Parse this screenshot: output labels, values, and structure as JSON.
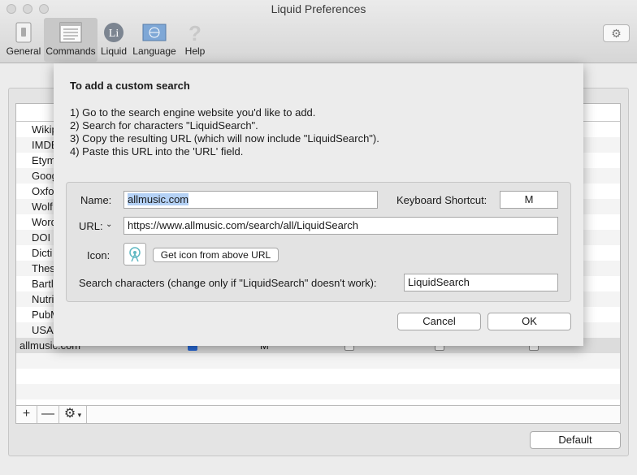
{
  "window": {
    "title": "Liquid Preferences"
  },
  "toolbar": {
    "items": [
      {
        "label": "General",
        "icon": "switch-icon"
      },
      {
        "label": "Commands",
        "icon": "list-window-icon",
        "selected": true
      },
      {
        "label": "Liquid",
        "icon": "liquid-logo-icon"
      },
      {
        "label": "Language",
        "icon": "globe-flag-icon"
      },
      {
        "label": "Help",
        "icon": "question-icon"
      }
    ]
  },
  "table": {
    "rows": [
      {
        "name": "Wikip"
      },
      {
        "name": "IMDB"
      },
      {
        "name": "Etym"
      },
      {
        "name": "Goog"
      },
      {
        "name": "Oxfo"
      },
      {
        "name": "Wolf"
      },
      {
        "name": "Word"
      },
      {
        "name": "DOI l"
      },
      {
        "name": "Dicti"
      },
      {
        "name": "Thes"
      },
      {
        "name": "Bartl"
      },
      {
        "name": "Nutri"
      },
      {
        "name": "PubM"
      },
      {
        "name": "USA"
      },
      {
        "name": "allmusic.com",
        "shortcut": "M",
        "enabled": true,
        "selected": true
      }
    ]
  },
  "bottom_bar": {
    "add": "+",
    "remove": "—",
    "action": "⚙"
  },
  "default_button": "Default",
  "sheet": {
    "title": "To add a custom search",
    "steps": [
      "1) Go to the search engine website you'd like to add.",
      "2) Search for characters \"LiquidSearch\".",
      "3) Copy the resulting URL (which will now include \"LiquidSearch\").",
      "4) Paste this URL into the 'URL' field."
    ],
    "name_label": "Name:",
    "name_value": "allmusic.com",
    "shortcut_label": "Keyboard Shortcut:",
    "shortcut_value": "M",
    "url_label": "URL:",
    "url_value": "https://www.allmusic.com/search/all/LiquidSearch",
    "icon_label": "Icon:",
    "get_icon_button": "Get icon from above URL",
    "search_chars_label": "Search characters (change only if \"LiquidSearch\" doesn't work):",
    "search_chars_value": "LiquidSearch",
    "cancel_button": "Cancel",
    "ok_button": "OK"
  },
  "colors": {
    "accent": "#2a6bd9",
    "selection": "#b4d1f5"
  }
}
